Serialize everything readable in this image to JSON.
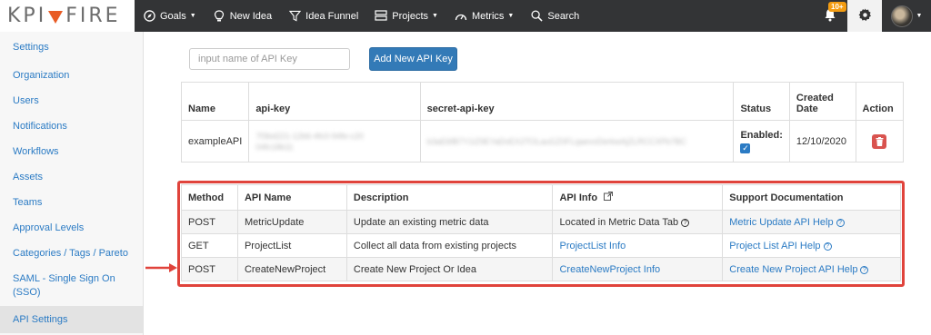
{
  "brand": {
    "logo_left": "KPI",
    "logo_right": "FIRE"
  },
  "nav": {
    "goals": "Goals",
    "new_idea": "New Idea",
    "idea_funnel": "Idea Funnel",
    "projects": "Projects",
    "metrics": "Metrics",
    "search": "Search",
    "notification_count": "10+"
  },
  "sidebar": {
    "items": [
      {
        "label": "Settings"
      },
      {
        "label": "Organization"
      },
      {
        "label": "Users"
      },
      {
        "label": "Notifications"
      },
      {
        "label": "Workflows"
      },
      {
        "label": "Assets"
      },
      {
        "label": "Teams"
      },
      {
        "label": "Approval Levels"
      },
      {
        "label": "Categories / Tags / Pareto"
      },
      {
        "label": "SAML - Single Sign On (SSO)"
      },
      {
        "label": "API Settings"
      }
    ]
  },
  "form": {
    "input_placeholder": "input name of API Key",
    "add_button": "Add New API Key"
  },
  "keys_table": {
    "headers": [
      "Name",
      "api-key",
      "secret-api-key",
      "Status",
      "Created Date",
      "Action"
    ],
    "row": {
      "name": "exampleAPI",
      "api_key": "7f3bd221-12b6-4fc0-94fe-c2004fc18b11",
      "secret": "b3aE6fB7Y1iZ9EYaDvEX2TOLauGZ0FLqaevoDerkwAjZLRCCXPb7BC",
      "status": "Enabled:",
      "created": "12/10/2020"
    }
  },
  "api_table": {
    "headers": [
      "Method",
      "API Name",
      "Description",
      "API Info",
      "Support Documentation"
    ],
    "rows": [
      {
        "method": "POST",
        "name": "MetricUpdate",
        "description": "Update an existing metric data",
        "info": "Located in Metric Data Tab",
        "support": "Metric Update API Help"
      },
      {
        "method": "GET",
        "name": "ProjectList",
        "description": "Collect all data from existing projects",
        "info": "ProjectList Info",
        "support": "Project List API Help"
      },
      {
        "method": "POST",
        "name": "CreateNewProject",
        "description": "Create New Project Or Idea",
        "info": "CreateNewProject Info",
        "support": "Create New Project API Help"
      }
    ]
  },
  "colors": {
    "accent": "#2b7bc4",
    "highlight": "#e0433b",
    "topbar": "#333436",
    "brand_flame": "#e85b24"
  }
}
